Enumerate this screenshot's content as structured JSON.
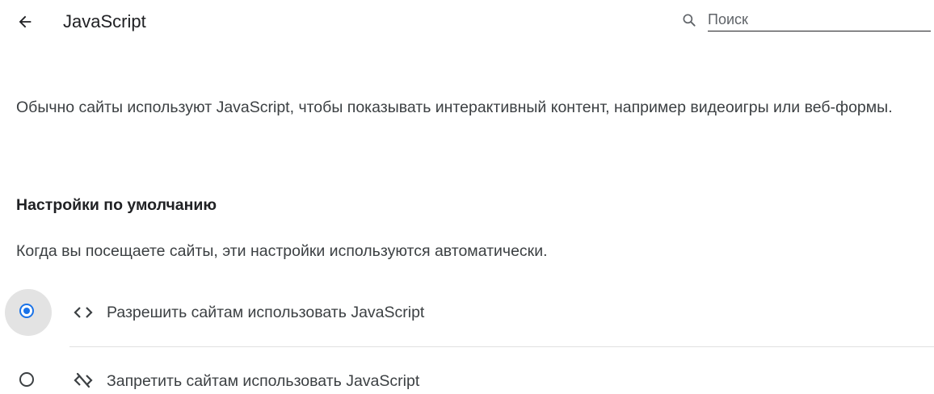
{
  "header": {
    "title": "JavaScript",
    "back_icon": "arrow-left-icon",
    "search": {
      "icon": "search-icon",
      "placeholder": "Поиск",
      "value": ""
    }
  },
  "description": "Обычно сайты используют JavaScript, чтобы показывать интерактивный контент, например видеоигры или веб-формы.",
  "defaults": {
    "title": "Настройки по умолчанию",
    "subtitle": "Когда вы посещаете сайты, эти настройки используются автоматически.",
    "options": [
      {
        "label": "Разрешить сайтам использовать JavaScript",
        "icon": "code-icon",
        "selected": true
      },
      {
        "label": "Запретить сайтам использовать JavaScript",
        "icon": "code-off-icon",
        "selected": false
      }
    ]
  },
  "colors": {
    "accent": "#1a73e8",
    "text_primary": "#202124",
    "text_secondary": "#3c4043",
    "radio_halo": "#e3e3e3",
    "divider": "#e0e0e0"
  }
}
